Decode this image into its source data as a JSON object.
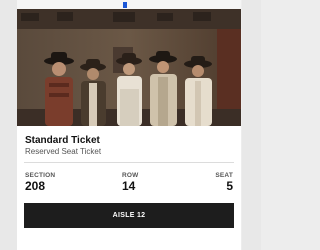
{
  "ticket": {
    "type": "Standard Ticket",
    "description": "Reserved Seat Ticket",
    "section_label": "SECTION",
    "section_value": "208",
    "row_label": "ROW",
    "row_value": "14",
    "seat_label": "SEAT",
    "seat_value": "5"
  },
  "aisle_button": {
    "label": "AISLE 12"
  },
  "colors": {
    "button_bg": "#1d1d1d",
    "accent": "#1b56d6"
  }
}
